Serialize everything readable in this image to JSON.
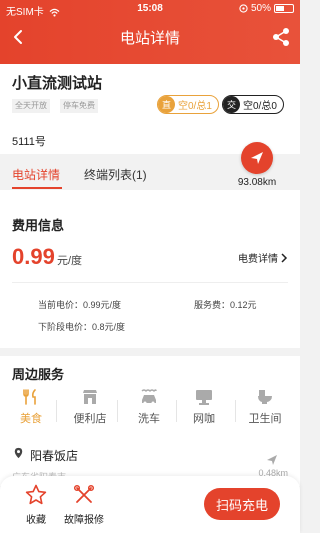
{
  "status_bar": {
    "carrier": "无SIM卡",
    "time": "15:08",
    "battery": "50%",
    "battery_level": 0.5
  },
  "nav": {
    "title": "电站详情"
  },
  "station": {
    "name": "小直流测试站",
    "tags": [
      "全天开放",
      "停车免费"
    ],
    "dc": {
      "badge": "直",
      "status": "空0/总1"
    },
    "ac": {
      "badge": "交",
      "status": "空0/总0"
    },
    "address": "5111号",
    "distance": "93.08km"
  },
  "tabs": {
    "detail": "电站详情",
    "terminals": "终端列表(1)"
  },
  "fees": {
    "title": "费用信息",
    "price": "0.99",
    "unit": "元/度",
    "detail_link": "电费详情",
    "current_price": "当前电价：0.99元/度",
    "service_fee": "服务费：0.12元",
    "next_price": "下阶段电价：0.8元/度"
  },
  "services": {
    "title": "周边服务",
    "items": [
      "美食",
      "便利店",
      "洗车",
      "网咖",
      "卫生间"
    ],
    "poi": {
      "name": "阳春饭店",
      "address": "广东省阳春市",
      "distance": "0.48km"
    }
  },
  "bottom": {
    "favorite": "收藏",
    "report": "故障报修",
    "scan": "扫码充电"
  },
  "colors": {
    "primary": "#e4432c",
    "accent": "#e9a23b"
  }
}
